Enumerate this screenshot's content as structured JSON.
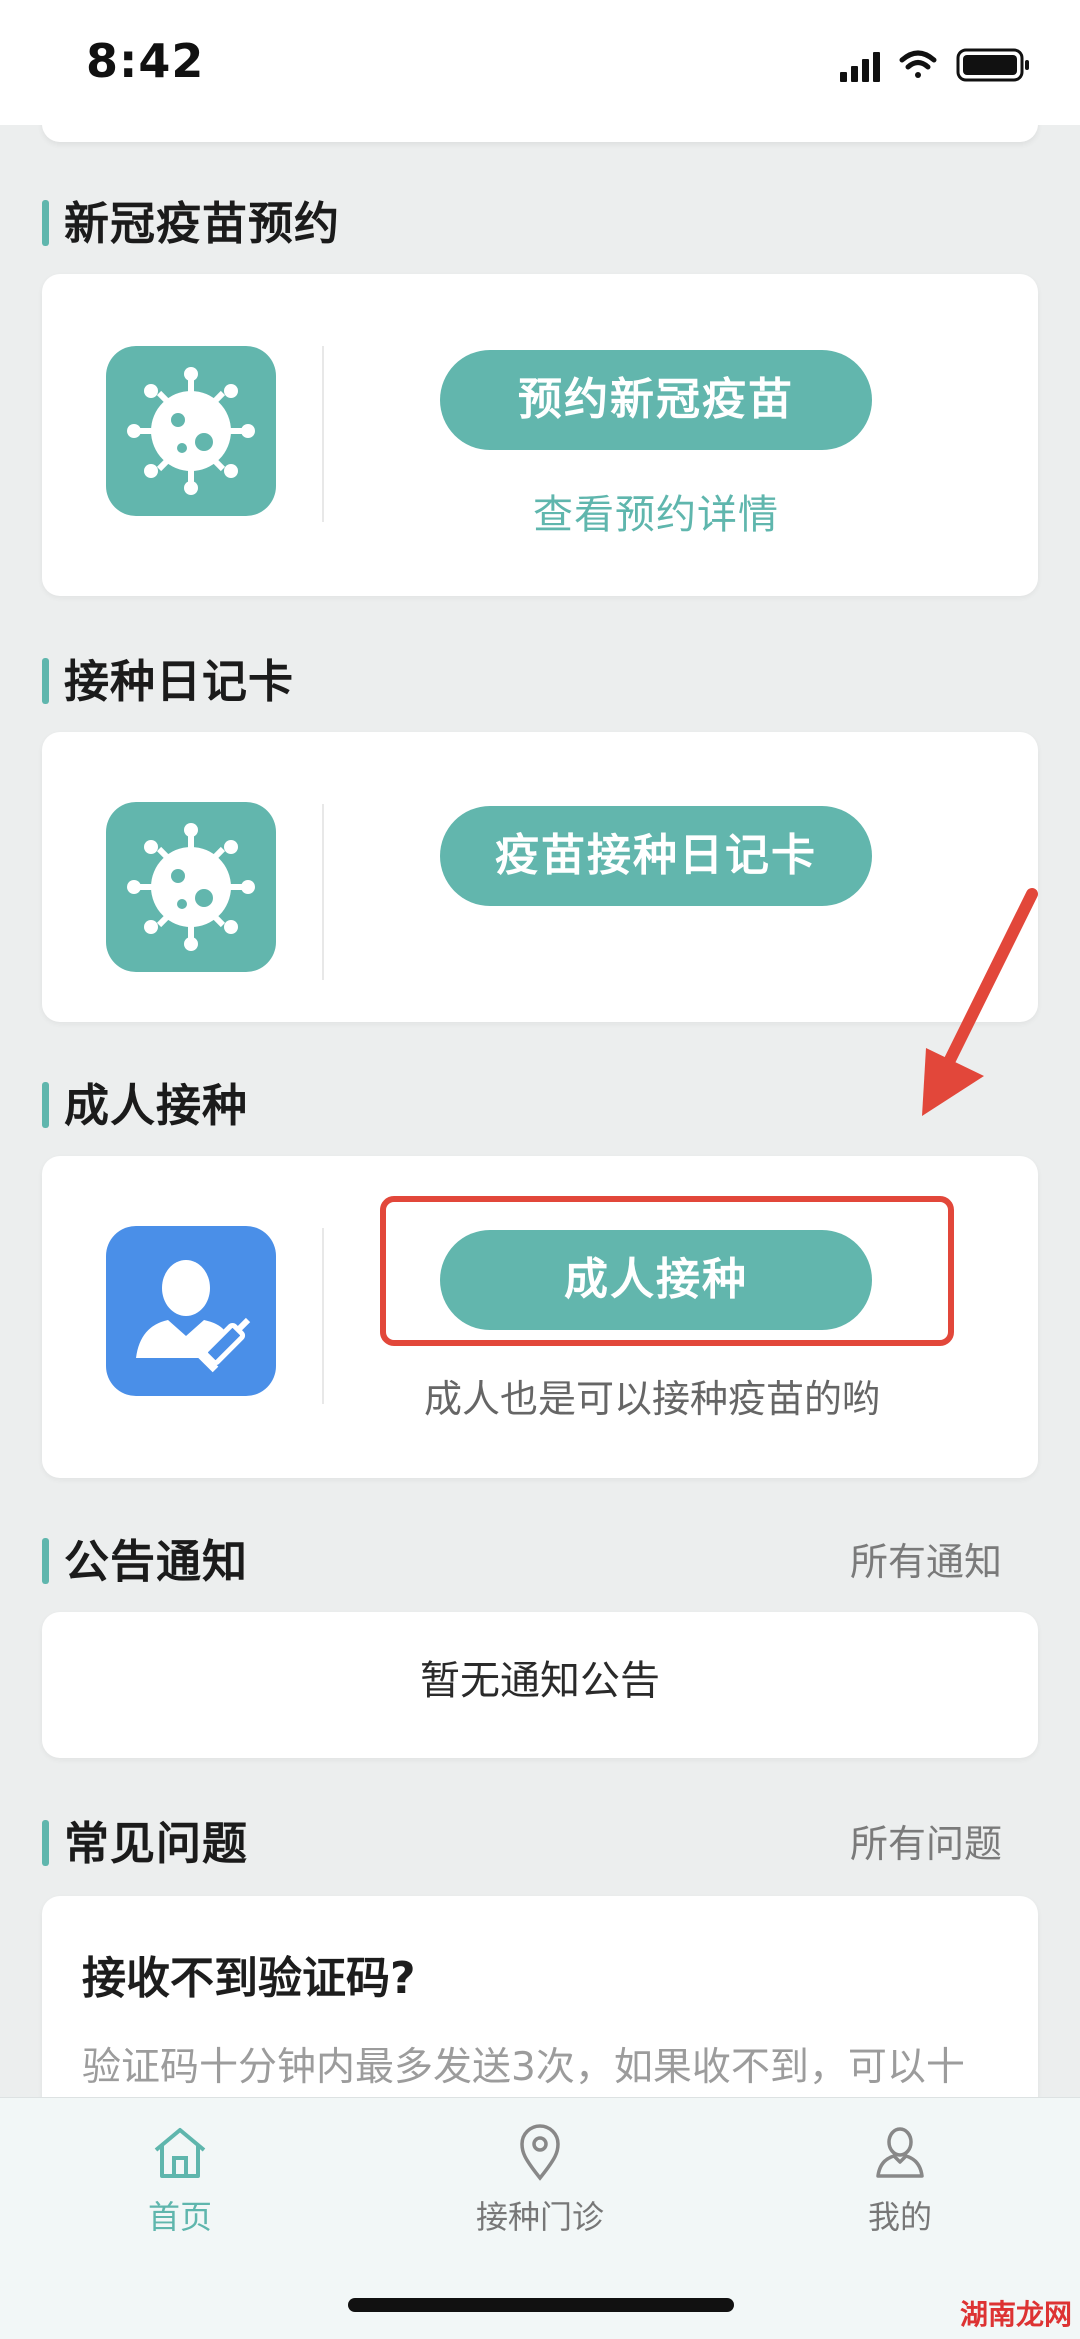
{
  "status_bar": {
    "time": "8:42"
  },
  "sections": {
    "covid_booking": {
      "title": "新冠疫苗预约",
      "button": "预约新冠疫苗",
      "link": "查看预约详情"
    },
    "diary": {
      "title": "接种日记卡",
      "button": "疫苗接种日记卡"
    },
    "adult": {
      "title": "成人接种",
      "button": "成人接种",
      "subtitle": "成人也是可以接种疫苗的哟"
    },
    "notices": {
      "title": "公告通知",
      "more": "所有通知",
      "empty": "暂无通知公告"
    },
    "faq": {
      "title": "常见问题",
      "more": "所有问题",
      "question": "接收不到验证码?",
      "answer": "验证码十分钟内最多发送3次，如果收不到，可以十"
    }
  },
  "tabs": [
    {
      "label": "首页",
      "icon": "home-icon",
      "active": true
    },
    {
      "label": "接种门诊",
      "icon": "location-pin-icon",
      "active": false
    },
    {
      "label": "我的",
      "icon": "user-icon",
      "active": false
    }
  ],
  "colors": {
    "accent": "#62b6ad",
    "adult_icon_bg": "#4a8fe8",
    "highlight": "#e2473a"
  },
  "watermark": "湖南龙网"
}
